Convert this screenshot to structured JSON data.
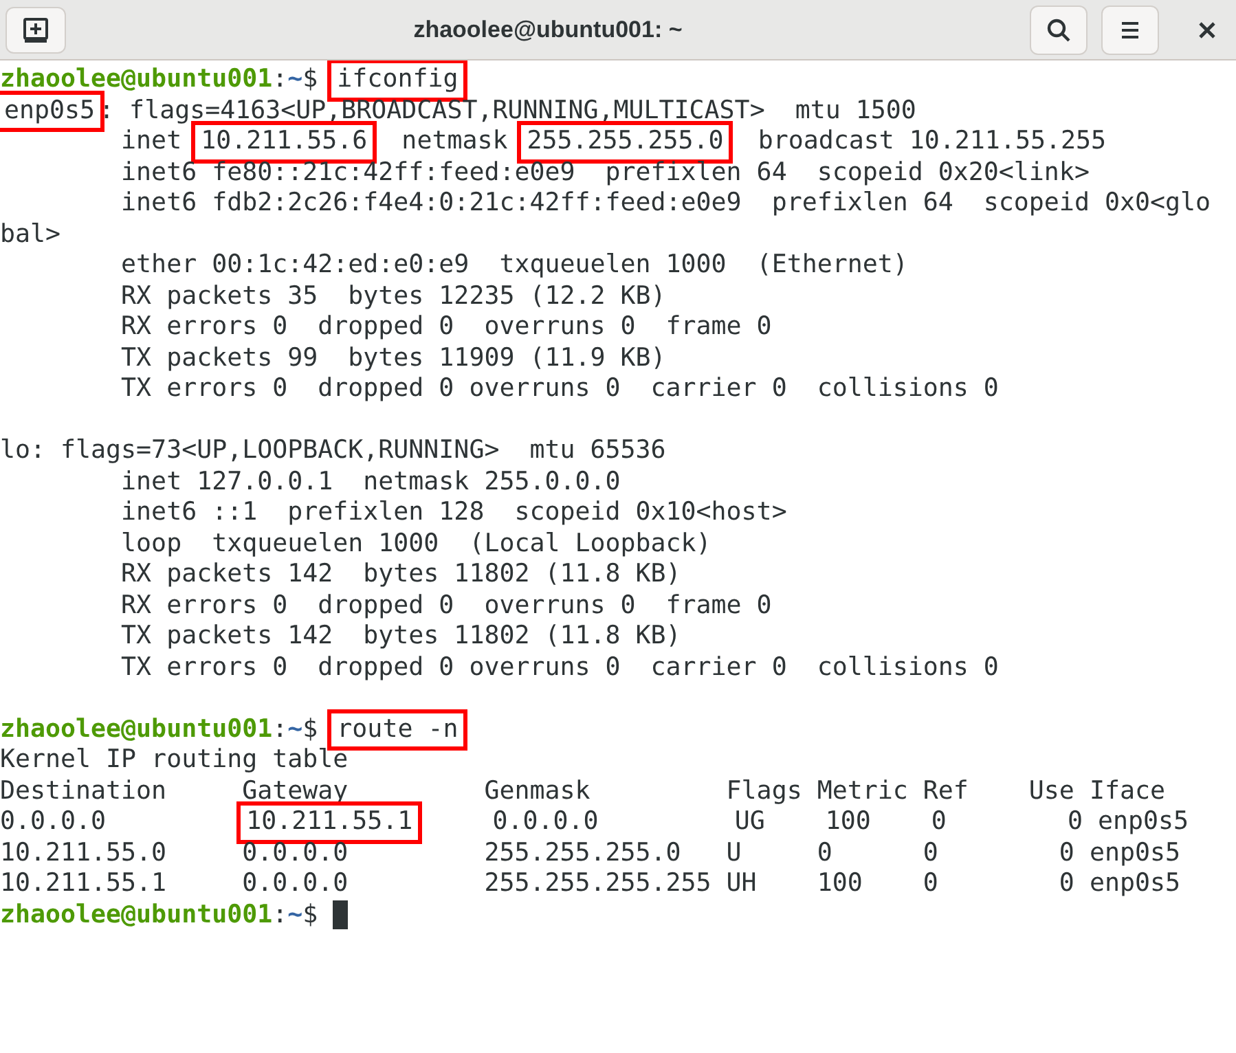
{
  "window": {
    "title": "zhaoolee@ubuntu001: ~"
  },
  "terminal": {
    "lines": [
      {
        "kind": "text",
        "segments": [
          {
            "kind": "user",
            "text": "zhaoolee@ubuntu001",
            "boxed": false
          },
          {
            "kind": "text",
            "text": ":",
            "boxed": false
          },
          {
            "kind": "path",
            "text": "~",
            "boxed": false
          },
          {
            "kind": "text",
            "text": "$ ",
            "boxed": false
          },
          {
            "kind": "text",
            "text": "ifconfig",
            "boxed": true
          }
        ]
      },
      {
        "kind": "text",
        "segments": [
          {
            "kind": "text",
            "text": "enp0s5",
            "boxed": true
          },
          {
            "kind": "text",
            "text": ": flags=4163<UP,BROADCAST,RUNNING,MULTICAST>  mtu 1500",
            "boxed": false
          }
        ]
      },
      {
        "kind": "text",
        "segments": [
          {
            "kind": "text",
            "text": "        inet ",
            "boxed": false
          },
          {
            "kind": "text",
            "text": "10.211.55.6",
            "boxed": true
          },
          {
            "kind": "text",
            "text": "  netmask ",
            "boxed": false
          },
          {
            "kind": "text",
            "text": "255.255.255.0",
            "boxed": true
          },
          {
            "kind": "text",
            "text": "  broadcast 10.211.55.255",
            "boxed": false
          }
        ]
      },
      {
        "kind": "text",
        "segments": [
          {
            "kind": "text",
            "text": "        inet6 fe80::21c:42ff:feed:e0e9  prefixlen 64  scopeid 0x20<link>",
            "boxed": false
          }
        ]
      },
      {
        "kind": "text",
        "segments": [
          {
            "kind": "text",
            "text": "        inet6 fdb2:2c26:f4e4:0:21c:42ff:feed:e0e9  prefixlen 64  scopeid 0x0<glo",
            "boxed": false
          }
        ]
      },
      {
        "kind": "text",
        "segments": [
          {
            "kind": "text",
            "text": "bal>",
            "boxed": false
          }
        ]
      },
      {
        "kind": "text",
        "segments": [
          {
            "kind": "text",
            "text": "        ether 00:1c:42:ed:e0:e9  txqueuelen 1000  (Ethernet)",
            "boxed": false
          }
        ]
      },
      {
        "kind": "text",
        "segments": [
          {
            "kind": "text",
            "text": "        RX packets 35  bytes 12235 (12.2 KB)",
            "boxed": false
          }
        ]
      },
      {
        "kind": "text",
        "segments": [
          {
            "kind": "text",
            "text": "        RX errors 0  dropped 0  overruns 0  frame 0",
            "boxed": false
          }
        ]
      },
      {
        "kind": "text",
        "segments": [
          {
            "kind": "text",
            "text": "        TX packets 99  bytes 11909 (11.9 KB)",
            "boxed": false
          }
        ]
      },
      {
        "kind": "text",
        "segments": [
          {
            "kind": "text",
            "text": "        TX errors 0  dropped 0 overruns 0  carrier 0  collisions 0",
            "boxed": false
          }
        ]
      },
      {
        "kind": "blank"
      },
      {
        "kind": "text",
        "segments": [
          {
            "kind": "text",
            "text": "lo: flags=73<UP,LOOPBACK,RUNNING>  mtu 65536",
            "boxed": false
          }
        ]
      },
      {
        "kind": "text",
        "segments": [
          {
            "kind": "text",
            "text": "        inet 127.0.0.1  netmask 255.0.0.0",
            "boxed": false
          }
        ]
      },
      {
        "kind": "text",
        "segments": [
          {
            "kind": "text",
            "text": "        inet6 ::1  prefixlen 128  scopeid 0x10<host>",
            "boxed": false
          }
        ]
      },
      {
        "kind": "text",
        "segments": [
          {
            "kind": "text",
            "text": "        loop  txqueuelen 1000  (Local Loopback)",
            "boxed": false
          }
        ]
      },
      {
        "kind": "text",
        "segments": [
          {
            "kind": "text",
            "text": "        RX packets 142  bytes 11802 (11.8 KB)",
            "boxed": false
          }
        ]
      },
      {
        "kind": "text",
        "segments": [
          {
            "kind": "text",
            "text": "        RX errors 0  dropped 0  overruns 0  frame 0",
            "boxed": false
          }
        ]
      },
      {
        "kind": "text",
        "segments": [
          {
            "kind": "text",
            "text": "        TX packets 142  bytes 11802 (11.8 KB)",
            "boxed": false
          }
        ]
      },
      {
        "kind": "text",
        "segments": [
          {
            "kind": "text",
            "text": "        TX errors 0  dropped 0 overruns 0  carrier 0  collisions 0",
            "boxed": false
          }
        ]
      },
      {
        "kind": "blank"
      },
      {
        "kind": "text",
        "segments": [
          {
            "kind": "user",
            "text": "zhaoolee@ubuntu001",
            "boxed": false
          },
          {
            "kind": "text",
            "text": ":",
            "boxed": false
          },
          {
            "kind": "path",
            "text": "~",
            "boxed": false
          },
          {
            "kind": "text",
            "text": "$ ",
            "boxed": false
          },
          {
            "kind": "text",
            "text": "route -n",
            "boxed": true
          }
        ]
      },
      {
        "kind": "text",
        "segments": [
          {
            "kind": "text",
            "text": "Kernel IP routing table",
            "boxed": false
          }
        ]
      },
      {
        "kind": "text",
        "segments": [
          {
            "kind": "text",
            "text": "Destination     Gateway         Genmask         Flags Metric Ref    Use Iface",
            "boxed": false
          }
        ]
      },
      {
        "kind": "text",
        "segments": [
          {
            "kind": "text",
            "text": "0.0.0.0         ",
            "boxed": false
          },
          {
            "kind": "text",
            "text": "10.211.55.1",
            "boxed": true
          },
          {
            "kind": "text",
            "text": "     0.0.0.0         UG    100    0        0 enp0s5",
            "boxed": false
          }
        ]
      },
      {
        "kind": "text",
        "segments": [
          {
            "kind": "text",
            "text": "10.211.55.0     0.0.0.0         255.255.255.0   U     0      0        0 enp0s5",
            "boxed": false
          }
        ]
      },
      {
        "kind": "text",
        "segments": [
          {
            "kind": "text",
            "text": "10.211.55.1     0.0.0.0         255.255.255.255 UH    100    0        0 enp0s5",
            "boxed": false
          }
        ]
      },
      {
        "kind": "text",
        "cursor": true,
        "segments": [
          {
            "kind": "user",
            "text": "zhaoolee@ubuntu001",
            "boxed": false
          },
          {
            "kind": "text",
            "text": ":",
            "boxed": false
          },
          {
            "kind": "path",
            "text": "~",
            "boxed": false
          },
          {
            "kind": "text",
            "text": "$ ",
            "boxed": false
          }
        ]
      }
    ]
  }
}
